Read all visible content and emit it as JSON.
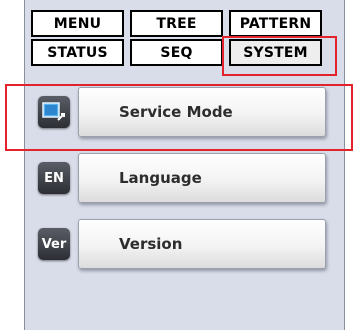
{
  "tabs": {
    "row1": [
      "MENU",
      "TREE",
      "PATTERN"
    ],
    "row2": [
      "STATUS",
      "SEQ",
      "SYSTEM"
    ],
    "active": "SYSTEM"
  },
  "items": [
    {
      "label": "Service Mode",
      "icon": "service-mode-icon"
    },
    {
      "label": "Language",
      "icon": "EN"
    },
    {
      "label": "Version",
      "icon": "Ver"
    }
  ],
  "colors": {
    "panel_bg": "#d9dde9",
    "highlight": "#e2232b",
    "icon_bg": "#3d4048"
  }
}
